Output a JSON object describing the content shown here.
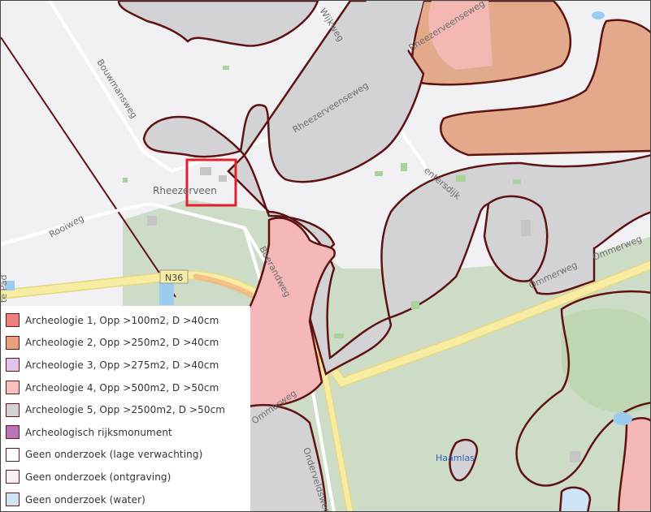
{
  "map": {
    "colors": {
      "outline": "#5e1212",
      "red_selection": "#e0202a",
      "grey_zone": "#d3d3d6",
      "pink_zone": "#f5b8b8",
      "orange_zone": "#e2a98a",
      "forest": "#cddcc6",
      "road_major": "#f4e79a",
      "water": "#b3d7f3"
    },
    "labels": {
      "wijkweg": "Wijkweg",
      "rheezerveensewegTop": "Rheezerveenseweg",
      "rheezerveensewegMid": "Rheezerveenseweg",
      "bouwmansweg": "Bouwmansweg",
      "rheezerveen": "Rheezerveen",
      "rooiweg": "Rooiweg",
      "padFragment": "te Pad",
      "route": "N36",
      "boerandweg": "Boerandweg",
      "centersdijk": "entersdijk",
      "ommerwegRight": "Ommerweg",
      "ommerwegMid": "Ommerweg",
      "ommerwegLow": "Ommerweg",
      "onderveldsweg": "Onderveldsweg",
      "haamlas": "Haamlas"
    }
  },
  "legend": {
    "items": [
      {
        "label": "Archeologie 1, Opp >100m2,  D >40cm",
        "fill": "#f08080"
      },
      {
        "label": "Archeologie 2, Opp >250m2,  D >40cm",
        "fill": "#e6a27e"
      },
      {
        "label": "Archeologie 3, Opp >275m2,  D >40cm",
        "fill": "#dcc6ef"
      },
      {
        "label": "Archeologie 4, Opp >500m2,  D >50cm",
        "fill": "#f7c1c1"
      },
      {
        "label": "Archeologie 5, Opp >2500m2,  D >50cm",
        "fill": "#d3d3d3"
      },
      {
        "label": "Archeologisch rijksmonument",
        "fill": "#b874b8"
      },
      {
        "label": "Geen onderzoek (lage verwachting)",
        "fill": "#ffffff"
      },
      {
        "label": "Geen onderzoek (ontgraving)",
        "fill": "#f7f1f1"
      },
      {
        "label": "Geen onderzoek (water)",
        "fill": "#cfe3f7"
      }
    ]
  }
}
